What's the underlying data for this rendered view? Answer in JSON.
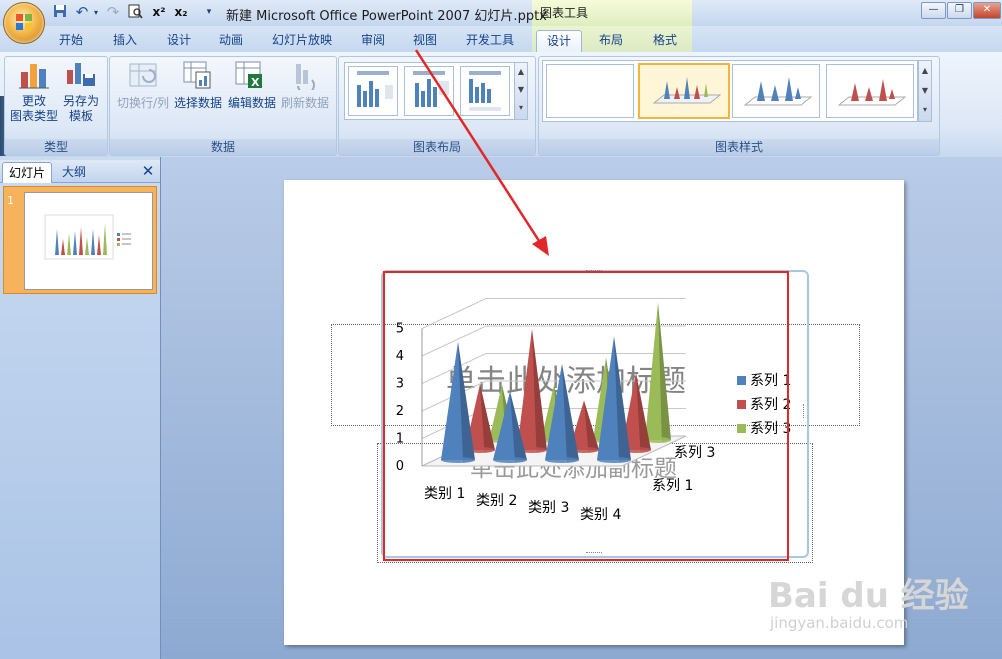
{
  "window": {
    "title": "新建 Microsoft Office PowerPoint 2007 幻灯片.pptx",
    "context_title": "图表工具",
    "qat_icons": [
      "save-icon",
      "undo-icon",
      "redo-icon",
      "print-preview-icon",
      "superscript-icon",
      "subscript-icon",
      "customize-qat-icon"
    ],
    "superscript_label": "x²",
    "subscript_label": "x₂"
  },
  "tabs": [
    {
      "label": "开始"
    },
    {
      "label": "插入"
    },
    {
      "label": "设计"
    },
    {
      "label": "动画"
    },
    {
      "label": "幻灯片放映"
    },
    {
      "label": "审阅"
    },
    {
      "label": "视图"
    },
    {
      "label": "开发工具"
    },
    {
      "label": "设计",
      "active": true
    },
    {
      "label": "布局"
    },
    {
      "label": "格式"
    }
  ],
  "ribbon": {
    "groups": {
      "type": {
        "label": "类型",
        "change_type_label1": "更改",
        "change_type_label2": "图表类型",
        "save_template_label1": "另存为",
        "save_template_label2": "模板"
      },
      "data": {
        "label": "数据",
        "switch_row_col": "切换行/列",
        "select_data": "选择数据",
        "edit_data": "编辑数据",
        "refresh_data": "刷新数据"
      },
      "layout": {
        "label": "图表布局"
      },
      "styles": {
        "label": "图表样式"
      }
    }
  },
  "left_pane": {
    "tab_slides": "幻灯片",
    "tab_outline": "大纲",
    "slide_number": "1"
  },
  "slide": {
    "title_placeholder": "单击此处添加标题",
    "subtitle_placeholder": "单击此处添加副标题"
  },
  "chart_data": {
    "type": "bar",
    "subtype": "3d-cone",
    "categories": [
      "类别 1",
      "类别 2",
      "类别 3",
      "类别 4"
    ],
    "series": [
      {
        "name": "系列 1",
        "color": "#4f81bd",
        "values": [
          4.3,
          2.5,
          3.5,
          4.5
        ]
      },
      {
        "name": "系列 2",
        "color": "#c0504d",
        "values": [
          2.4,
          4.4,
          1.8,
          2.8
        ]
      },
      {
        "name": "系列 3",
        "color": "#9bbb59",
        "values": [
          2.0,
          2.0,
          3.0,
          5.0
        ]
      }
    ],
    "depth_axis_labels": [
      "系列 3",
      "系列 1"
    ],
    "y_ticks": [
      "0",
      "1",
      "2",
      "3",
      "4",
      "5"
    ],
    "ylim": [
      0,
      5
    ],
    "grid": true,
    "legend_position": "right"
  },
  "watermark": {
    "logo_text": "Bai du 经验",
    "url": "jingyan.baidu.com"
  },
  "colors": {
    "annotation": "#e02828",
    "ribbon_text": "#15428b",
    "context_tab": "#dbeac4"
  }
}
